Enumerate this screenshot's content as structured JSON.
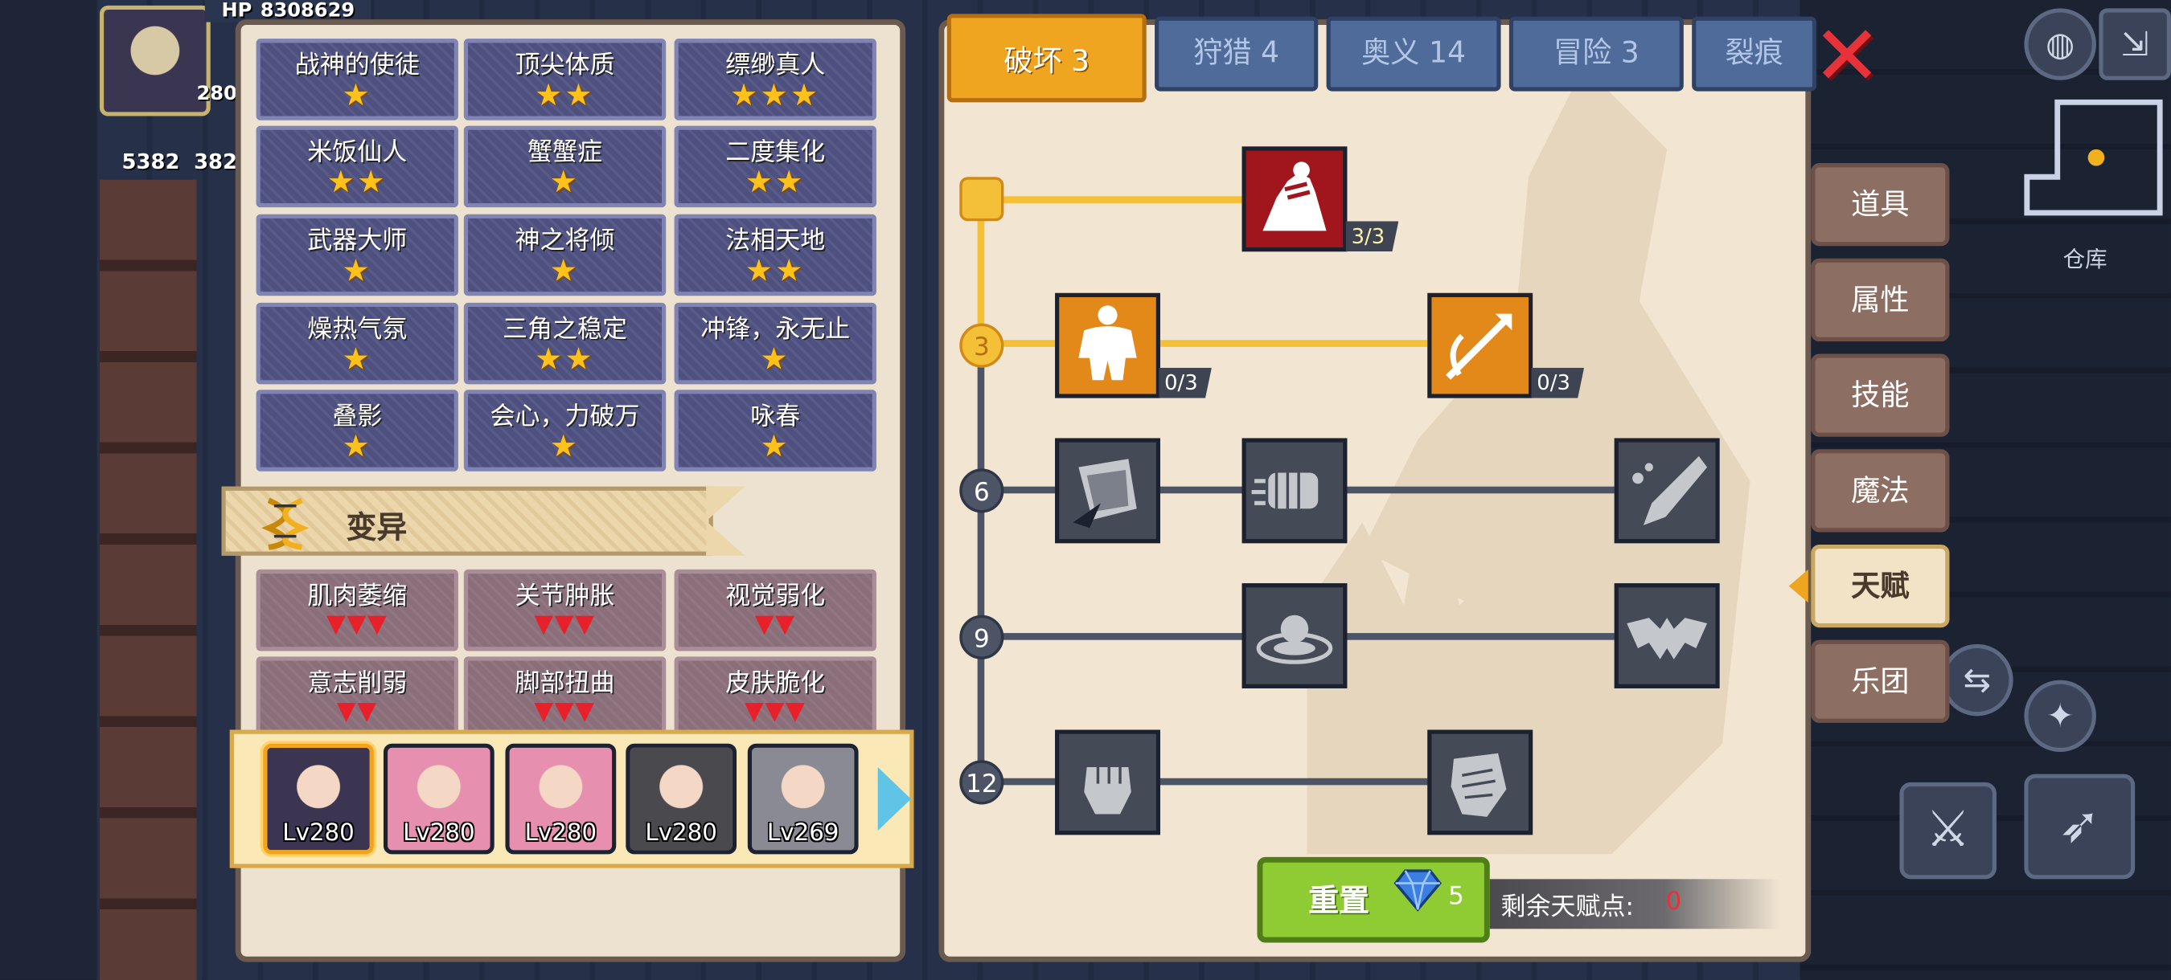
{
  "hud": {
    "hp_label": "HP",
    "hp_value": "8308629",
    "level_badge": "280",
    "res1": "5382",
    "res2": "382"
  },
  "traits": [
    {
      "name": "战神的使徒",
      "stars": "★"
    },
    {
      "name": "顶尖体质",
      "stars": "★★"
    },
    {
      "name": "缥缈真人",
      "stars": "★★★"
    },
    {
      "name": "米饭仙人",
      "stars": "★★"
    },
    {
      "name": "蟹蟹症",
      "stars": "★"
    },
    {
      "name": "二度集化",
      "stars": "★★"
    },
    {
      "name": "武器大师",
      "stars": "★"
    },
    {
      "name": "神之将倾",
      "stars": "★"
    },
    {
      "name": "法相天地",
      "stars": "★★"
    },
    {
      "name": "燥热气氛",
      "stars": "★"
    },
    {
      "name": "三角之稳定",
      "stars": "★★"
    },
    {
      "name": "冲锋，永无止",
      "stars": "★"
    },
    {
      "name": "叠影",
      "stars": "★"
    },
    {
      "name": "会心，力破万",
      "stars": "★"
    },
    {
      "name": "咏春",
      "stars": "★"
    }
  ],
  "mutation_section": {
    "title": "变异"
  },
  "mutations": [
    {
      "name": "肌肉萎缩",
      "marks": "▼▼▼"
    },
    {
      "name": "关节肿胀",
      "marks": "▼▼▼"
    },
    {
      "name": "视觉弱化",
      "marks": "▼▼"
    },
    {
      "name": "意志削弱",
      "marks": "▼▼"
    },
    {
      "name": "脚部扭曲",
      "marks": "▼▼▼"
    },
    {
      "name": "皮肤脆化",
      "marks": "▼▼▼"
    }
  ],
  "heroes": [
    {
      "level": "Lv280",
      "selected": true,
      "color": "#3b3552"
    },
    {
      "level": "Lv280",
      "selected": false,
      "color": "#e78fae"
    },
    {
      "level": "Lv280",
      "selected": false,
      "color": "#e78fae"
    },
    {
      "level": "Lv280",
      "selected": false,
      "color": "#4a4a4e"
    },
    {
      "level": "Lv269",
      "selected": false,
      "color": "#8a8a94"
    }
  ],
  "tabs": [
    "破坏 3",
    "狩猎 4",
    "奥义 14",
    "冒险 3",
    "裂痕"
  ],
  "tree": {
    "levels": [
      "3",
      "6",
      "9",
      "12"
    ],
    "counts": {
      "row1": "3/3",
      "row2a": "0/3",
      "row2b": "0/3"
    }
  },
  "icons": {
    "row1": "arm-wrestle-icon",
    "row2a": "muscle-body-icon",
    "row2b": "arrow-hit-icon",
    "row3a": "shield-break-icon",
    "row3b": "punch-icon",
    "row3c": "blade-slash-icon",
    "row4a": "ground-impact-icon",
    "row4b": "bat-wing-icon",
    "row5a": "fist-icon",
    "row5b": "fist-grip-icon"
  },
  "reset": {
    "label": "重置",
    "cost": "5"
  },
  "points": {
    "label": "剩余天赋点:",
    "value": "0"
  },
  "side_menu": [
    "道具",
    "属性",
    "技能",
    "魔法",
    "天赋",
    "乐团"
  ],
  "side_active": "天赋",
  "storage_label": "仓库",
  "colors": {
    "gold": "#f4c037",
    "orange": "#f0a521",
    "red": "#e8323a",
    "trait_bg": "#4e5080",
    "mutation_bg": "#8a6e7a"
  }
}
